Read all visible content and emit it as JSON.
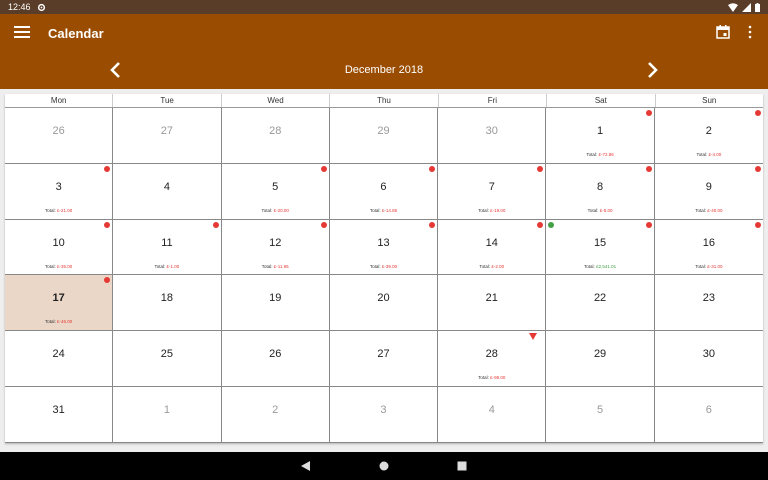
{
  "status_bar": {
    "time": "12:46"
  },
  "app_bar": {
    "title": "Calendar",
    "month_label": "December 2018",
    "icons": {
      "menu": "hamburger-menu-icon",
      "calendar": "calendar-icon",
      "more": "more-vert-icon",
      "prev": "chevron-left-icon",
      "next": "chevron-right-icon"
    }
  },
  "calendar": {
    "weekdays": [
      "Mon",
      "Tue",
      "Wed",
      "Thu",
      "Fri",
      "Sat",
      "Sun"
    ],
    "total_label": "Total:",
    "today": "17",
    "colors": {
      "header": "#9a4d00",
      "expense": "#e53935",
      "income": "#43a047",
      "today_bg": "#ead7c7"
    },
    "days": [
      {
        "day": "26",
        "in_month": false
      },
      {
        "day": "27",
        "in_month": false
      },
      {
        "day": "28",
        "in_month": false
      },
      {
        "day": "29",
        "in_month": false
      },
      {
        "day": "30",
        "in_month": false
      },
      {
        "day": "1",
        "in_month": true,
        "total": "£-72.86",
        "marker": "red-dot"
      },
      {
        "day": "2",
        "in_month": true,
        "total": "£-4.00",
        "marker": "red-dot"
      },
      {
        "day": "3",
        "in_month": true,
        "total": "£-21.00",
        "marker": "red-dot"
      },
      {
        "day": "4",
        "in_month": true
      },
      {
        "day": "5",
        "in_month": true,
        "total": "£-20.00",
        "marker": "red-dot"
      },
      {
        "day": "6",
        "in_month": true,
        "total": "£-14.85",
        "marker": "red-dot"
      },
      {
        "day": "7",
        "in_month": true,
        "total": "£-19.00",
        "marker": "red-dot"
      },
      {
        "day": "8",
        "in_month": true,
        "total": "£-5.00",
        "marker": "red-dot"
      },
      {
        "day": "9",
        "in_month": true,
        "total": "£-40.00",
        "marker": "red-dot"
      },
      {
        "day": "10",
        "in_month": true,
        "total": "£-35.00",
        "marker": "red-dot"
      },
      {
        "day": "11",
        "in_month": true,
        "total": "£-1.00",
        "marker": "red-dot"
      },
      {
        "day": "12",
        "in_month": true,
        "total": "£-11.95",
        "marker": "red-dot"
      },
      {
        "day": "13",
        "in_month": true,
        "total": "£-39.00",
        "marker": "red-dot"
      },
      {
        "day": "14",
        "in_month": true,
        "total": "£-2.00",
        "marker": "red-dot"
      },
      {
        "day": "15",
        "in_month": true,
        "total": "£2,541.01",
        "positive": true,
        "marker": "green-red-dots"
      },
      {
        "day": "16",
        "in_month": true,
        "total": "£-31.00",
        "marker": "red-dot"
      },
      {
        "day": "17",
        "in_month": true,
        "total": "£-46.00",
        "marker": "red-dot"
      },
      {
        "day": "18",
        "in_month": true
      },
      {
        "day": "19",
        "in_month": true
      },
      {
        "day": "20",
        "in_month": true
      },
      {
        "day": "21",
        "in_month": true
      },
      {
        "day": "22",
        "in_month": true
      },
      {
        "day": "23",
        "in_month": true
      },
      {
        "day": "24",
        "in_month": true
      },
      {
        "day": "25",
        "in_month": true
      },
      {
        "day": "26",
        "in_month": true
      },
      {
        "day": "27",
        "in_month": true
      },
      {
        "day": "28",
        "in_month": true,
        "total": "£-98.00",
        "marker": "red-triangle"
      },
      {
        "day": "29",
        "in_month": true
      },
      {
        "day": "30",
        "in_month": true
      },
      {
        "day": "31",
        "in_month": true
      },
      {
        "day": "1",
        "in_month": false
      },
      {
        "day": "2",
        "in_month": false
      },
      {
        "day": "3",
        "in_month": false
      },
      {
        "day": "4",
        "in_month": false
      },
      {
        "day": "5",
        "in_month": false
      },
      {
        "day": "6",
        "in_month": false
      }
    ]
  },
  "nav_bar": {
    "icons": [
      "back-triangle-icon",
      "home-circle-icon",
      "recents-square-icon"
    ]
  }
}
